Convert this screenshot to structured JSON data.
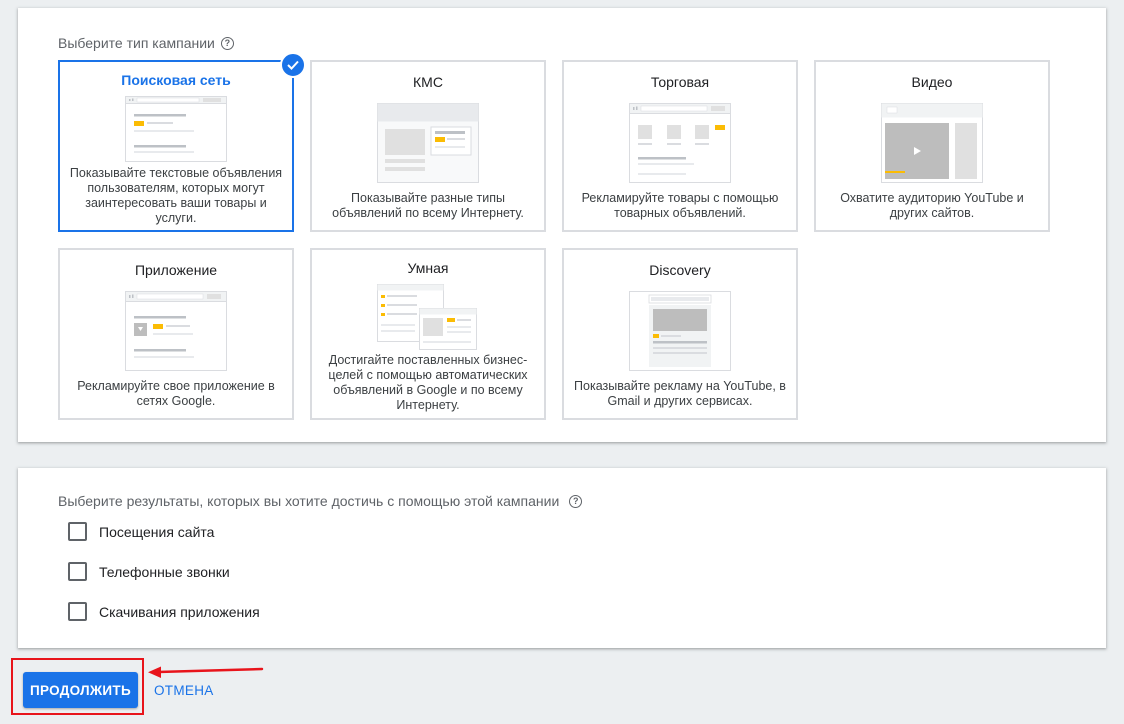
{
  "campaign_type": {
    "label": "Выберите тип кампании",
    "cards": [
      {
        "title": "Поисковая сеть",
        "desc": "Показывайте текстовые объявления пользователям, которых могут заинтересовать ваши товары и услуги.",
        "selected": true
      },
      {
        "title": "КМС",
        "desc": "Показывайте разные типы объявлений по всему Интернету.",
        "selected": false
      },
      {
        "title": "Торговая",
        "desc": "Рекламируйте товары с помощью товарных объявлений.",
        "selected": false
      },
      {
        "title": "Видео",
        "desc": "Охватите аудиторию YouTube и других сайтов.",
        "selected": false
      },
      {
        "title": "Приложение",
        "desc": "Рекламируйте свое приложение в сетях Google.",
        "selected": false
      },
      {
        "title": "Умная",
        "desc": "Достигайте поставленных бизнес-целей с помощью автоматических объявлений в Google и по всему Интернету.",
        "selected": false
      },
      {
        "title": "Discovery",
        "desc": "Показывайте рекламу на YouTube, в Gmail и других сервисах.",
        "selected": false
      }
    ]
  },
  "goals": {
    "label": "Выберите результаты, которых вы хотите достичь с помощью этой кампании",
    "options": [
      {
        "label": "Посещения сайта",
        "checked": false
      },
      {
        "label": "Телефонные звонки",
        "checked": false
      },
      {
        "label": "Скачивания приложения",
        "checked": false
      }
    ]
  },
  "actions": {
    "continue_label": "ПРОДОЛЖИТЬ",
    "cancel_label": "ОТМЕНА"
  },
  "colors": {
    "accent": "#1a73e8",
    "highlight": "#e8141b",
    "ad_yellow": "#fbbc04"
  }
}
